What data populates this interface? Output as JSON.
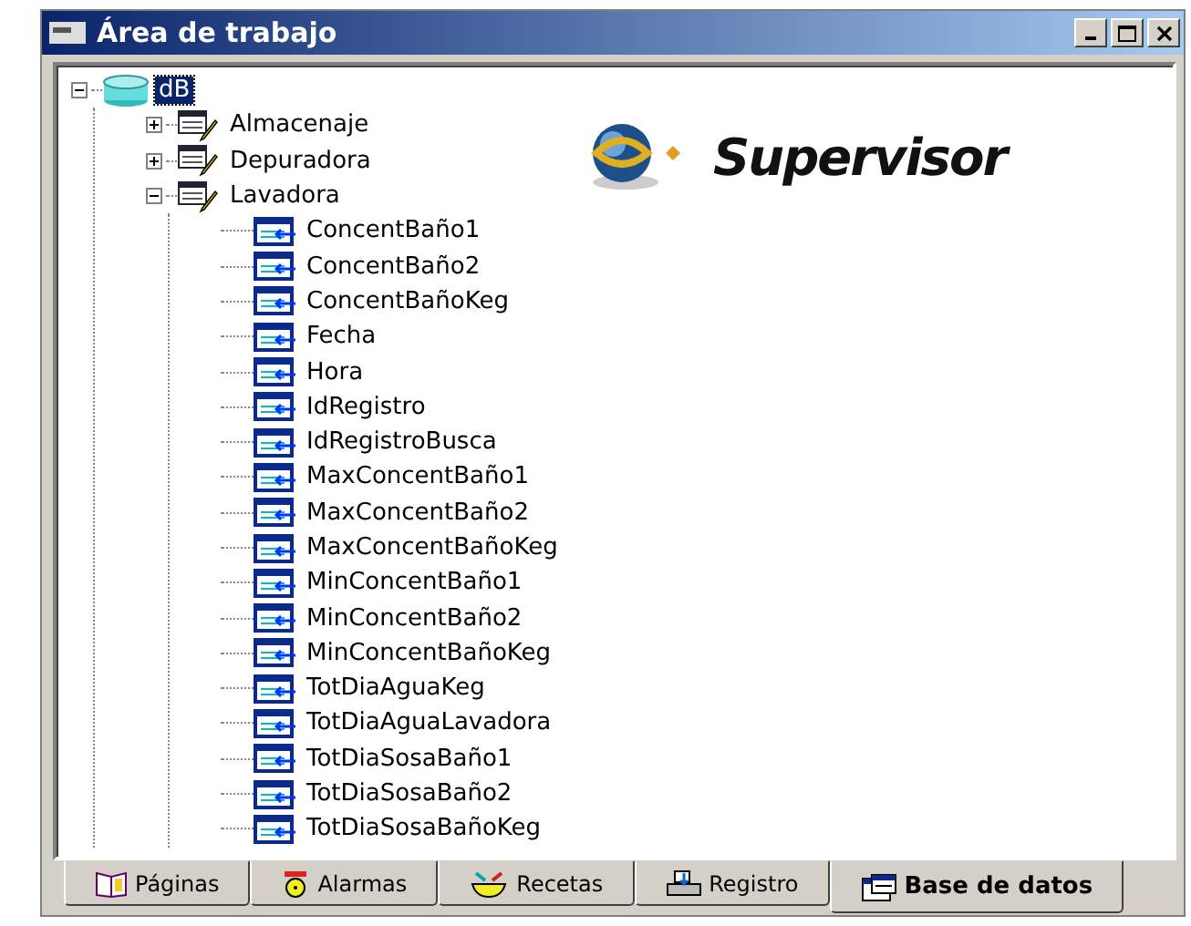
{
  "window": {
    "title": "Área de trabajo"
  },
  "logo": {
    "text": "Supervisor"
  },
  "tree": [
    {
      "label": "dB",
      "kind": "database",
      "selected": true,
      "expanded": true,
      "children": [
        {
          "label": "Almacenaje",
          "kind": "table",
          "selected": false,
          "expanded": false
        },
        {
          "label": "Depuradora",
          "kind": "table",
          "selected": false,
          "expanded": false
        },
        {
          "label": "Lavadora",
          "kind": "table",
          "selected": false,
          "expanded": true,
          "children": [
            {
              "label": "ConcentBaño1",
              "kind": "field",
              "selected": false
            },
            {
              "label": "ConcentBaño2",
              "kind": "field",
              "selected": false
            },
            {
              "label": "ConcentBañoKeg",
              "kind": "field",
              "selected": false
            },
            {
              "label": "Fecha",
              "kind": "field",
              "selected": false
            },
            {
              "label": "Hora",
              "kind": "field",
              "selected": false
            },
            {
              "label": "IdRegistro",
              "kind": "field",
              "selected": false
            },
            {
              "label": "IdRegistroBusca",
              "kind": "field",
              "selected": false
            },
            {
              "label": "MaxConcentBaño1",
              "kind": "field",
              "selected": false
            },
            {
              "label": "MaxConcentBaño2",
              "kind": "field",
              "selected": false
            },
            {
              "label": "MaxConcentBañoKeg",
              "kind": "field",
              "selected": false
            },
            {
              "label": "MinConcentBaño1",
              "kind": "field",
              "selected": false
            },
            {
              "label": "MinConcentBaño2",
              "kind": "field",
              "selected": false
            },
            {
              "label": "MinConcentBañoKeg",
              "kind": "field",
              "selected": false
            },
            {
              "label": "TotDiaAguaKeg",
              "kind": "field",
              "selected": false
            },
            {
              "label": "TotDiaAguaLavadora",
              "kind": "field",
              "selected": false
            },
            {
              "label": "TotDiaSosaBaño1",
              "kind": "field",
              "selected": false
            },
            {
              "label": "TotDiaSosaBaño2",
              "kind": "field",
              "selected": false
            },
            {
              "label": "TotDiaSosaBañoKeg",
              "kind": "field",
              "selected": false
            }
          ]
        }
      ]
    }
  ],
  "tabs": [
    {
      "label": "Páginas",
      "kind": "book",
      "selected": false
    },
    {
      "label": "Alarmas",
      "kind": "bell",
      "selected": false
    },
    {
      "label": "Recetas",
      "kind": "bowl",
      "selected": false
    },
    {
      "label": "Registro",
      "kind": "printer",
      "selected": false
    },
    {
      "label": "Base de datos",
      "kind": "grid",
      "selected": true
    }
  ]
}
